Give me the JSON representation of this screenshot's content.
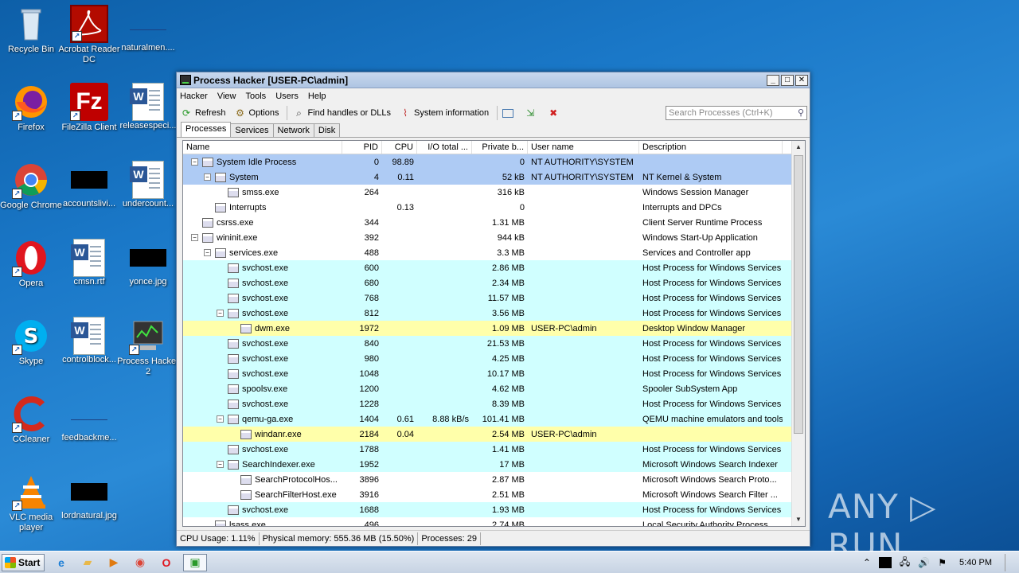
{
  "desktop": {
    "icons": [
      {
        "label": "Recycle Bin"
      },
      {
        "label": "Acrobat Reader DC"
      },
      {
        "label": "naturalmen...."
      },
      {
        "label": "Firefox"
      },
      {
        "label": "FileZilla Client"
      },
      {
        "label": "releasespeci..."
      },
      {
        "label": "Google Chrome"
      },
      {
        "label": "accountslivi..."
      },
      {
        "label": "undercount..."
      },
      {
        "label": "Opera"
      },
      {
        "label": "cmsn.rtf"
      },
      {
        "label": "yonce.jpg"
      },
      {
        "label": "Skype"
      },
      {
        "label": "controlblock..."
      },
      {
        "label": "Process Hacker 2"
      },
      {
        "label": "CCleaner"
      },
      {
        "label": "feedbackme..."
      },
      {
        "label": "VLC media player"
      },
      {
        "label": "lordnatural.jpg"
      }
    ]
  },
  "window": {
    "title": "Process Hacker [USER-PC\\admin]",
    "controls": {
      "minimize": "_",
      "maximize": "□",
      "close": "✕"
    },
    "menu": [
      "Hacker",
      "View",
      "Tools",
      "Users",
      "Help"
    ],
    "toolbar": {
      "refresh": "Refresh",
      "options": "Options",
      "find": "Find handles or DLLs",
      "sysinfo": "System information"
    },
    "search_placeholder": "Search Processes (Ctrl+K)",
    "tabs": [
      "Processes",
      "Services",
      "Network",
      "Disk"
    ],
    "columns": {
      "name": "Name",
      "pid": "PID",
      "cpu": "CPU",
      "io": "I/O total ...",
      "priv": "Private b...",
      "user": "User name",
      "desc": "Description"
    },
    "rows": [
      {
        "name": "System Idle Process",
        "pid": "0",
        "cpu": "98.89",
        "io": "",
        "priv": "0",
        "user": "NT AUTHORITY\\SYSTEM",
        "desc": "",
        "depth": 0,
        "toggle": "−",
        "color": "blue"
      },
      {
        "name": "System",
        "pid": "4",
        "cpu": "0.11",
        "io": "",
        "priv": "52 kB",
        "user": "NT AUTHORITY\\SYSTEM",
        "desc": "NT Kernel & System",
        "depth": 1,
        "toggle": "−",
        "color": "blue"
      },
      {
        "name": "smss.exe",
        "pid": "264",
        "cpu": "",
        "io": "",
        "priv": "316 kB",
        "user": "",
        "desc": "Windows Session Manager",
        "depth": 2,
        "toggle": "",
        "color": "white"
      },
      {
        "name": "Interrupts",
        "pid": "",
        "cpu": "0.13",
        "io": "",
        "priv": "0",
        "user": "",
        "desc": "Interrupts and DPCs",
        "depth": 1,
        "toggle": "",
        "color": "white"
      },
      {
        "name": "csrss.exe",
        "pid": "344",
        "cpu": "",
        "io": "",
        "priv": "1.31 MB",
        "user": "",
        "desc": "Client Server Runtime Process",
        "depth": 0,
        "toggle": "",
        "color": "white"
      },
      {
        "name": "wininit.exe",
        "pid": "392",
        "cpu": "",
        "io": "",
        "priv": "944 kB",
        "user": "",
        "desc": "Windows Start-Up Application",
        "depth": 0,
        "toggle": "−",
        "color": "white"
      },
      {
        "name": "services.exe",
        "pid": "488",
        "cpu": "",
        "io": "",
        "priv": "3.3 MB",
        "user": "",
        "desc": "Services and Controller app",
        "depth": 1,
        "toggle": "−",
        "color": "white"
      },
      {
        "name": "svchost.exe",
        "pid": "600",
        "cpu": "",
        "io": "",
        "priv": "2.86 MB",
        "user": "",
        "desc": "Host Process for Windows Services",
        "depth": 2,
        "toggle": "",
        "color": "cyan"
      },
      {
        "name": "svchost.exe",
        "pid": "680",
        "cpu": "",
        "io": "",
        "priv": "2.34 MB",
        "user": "",
        "desc": "Host Process for Windows Services",
        "depth": 2,
        "toggle": "",
        "color": "cyan"
      },
      {
        "name": "svchost.exe",
        "pid": "768",
        "cpu": "",
        "io": "",
        "priv": "11.57 MB",
        "user": "",
        "desc": "Host Process for Windows Services",
        "depth": 2,
        "toggle": "",
        "color": "cyan"
      },
      {
        "name": "svchost.exe",
        "pid": "812",
        "cpu": "",
        "io": "",
        "priv": "3.56 MB",
        "user": "",
        "desc": "Host Process for Windows Services",
        "depth": 2,
        "toggle": "−",
        "color": "cyan"
      },
      {
        "name": "dwm.exe",
        "pid": "1972",
        "cpu": "",
        "io": "",
        "priv": "1.09 MB",
        "user": "USER-PC\\admin",
        "desc": "Desktop Window Manager",
        "depth": 3,
        "toggle": "",
        "color": "yellow"
      },
      {
        "name": "svchost.exe",
        "pid": "840",
        "cpu": "",
        "io": "",
        "priv": "21.53 MB",
        "user": "",
        "desc": "Host Process for Windows Services",
        "depth": 2,
        "toggle": "",
        "color": "cyan"
      },
      {
        "name": "svchost.exe",
        "pid": "980",
        "cpu": "",
        "io": "",
        "priv": "4.25 MB",
        "user": "",
        "desc": "Host Process for Windows Services",
        "depth": 2,
        "toggle": "",
        "color": "cyan"
      },
      {
        "name": "svchost.exe",
        "pid": "1048",
        "cpu": "",
        "io": "",
        "priv": "10.17 MB",
        "user": "",
        "desc": "Host Process for Windows Services",
        "depth": 2,
        "toggle": "",
        "color": "cyan"
      },
      {
        "name": "spoolsv.exe",
        "pid": "1200",
        "cpu": "",
        "io": "",
        "priv": "4.62 MB",
        "user": "",
        "desc": "Spooler SubSystem App",
        "depth": 2,
        "toggle": "",
        "color": "cyan"
      },
      {
        "name": "svchost.exe",
        "pid": "1228",
        "cpu": "",
        "io": "",
        "priv": "8.39 MB",
        "user": "",
        "desc": "Host Process for Windows Services",
        "depth": 2,
        "toggle": "",
        "color": "cyan"
      },
      {
        "name": "qemu-ga.exe",
        "pid": "1404",
        "cpu": "0.61",
        "io": "8.88 kB/s",
        "priv": "101.41 MB",
        "user": "",
        "desc": "QEMU machine emulators and tools",
        "depth": 2,
        "toggle": "−",
        "color": "cyan"
      },
      {
        "name": "windanr.exe",
        "pid": "2184",
        "cpu": "0.04",
        "io": "",
        "priv": "2.54 MB",
        "user": "USER-PC\\admin",
        "desc": "",
        "depth": 3,
        "toggle": "",
        "color": "yellow"
      },
      {
        "name": "svchost.exe",
        "pid": "1788",
        "cpu": "",
        "io": "",
        "priv": "1.41 MB",
        "user": "",
        "desc": "Host Process for Windows Services",
        "depth": 2,
        "toggle": "",
        "color": "cyan"
      },
      {
        "name": "SearchIndexer.exe",
        "pid": "1952",
        "cpu": "",
        "io": "",
        "priv": "17 MB",
        "user": "",
        "desc": "Microsoft Windows Search Indexer",
        "depth": 2,
        "toggle": "−",
        "color": "cyan"
      },
      {
        "name": "SearchProtocolHos...",
        "pid": "3896",
        "cpu": "",
        "io": "",
        "priv": "2.87 MB",
        "user": "",
        "desc": "Microsoft Windows Search Proto...",
        "depth": 3,
        "toggle": "",
        "color": "white"
      },
      {
        "name": "SearchFilterHost.exe",
        "pid": "3916",
        "cpu": "",
        "io": "",
        "priv": "2.51 MB",
        "user": "",
        "desc": "Microsoft Windows Search Filter ...",
        "depth": 3,
        "toggle": "",
        "color": "white"
      },
      {
        "name": "svchost.exe",
        "pid": "1688",
        "cpu": "",
        "io": "",
        "priv": "1.93 MB",
        "user": "",
        "desc": "Host Process for Windows Services",
        "depth": 2,
        "toggle": "",
        "color": "cyan"
      },
      {
        "name": "lsass.exe",
        "pid": "496",
        "cpu": "",
        "io": "",
        "priv": "2.74 MB",
        "user": "",
        "desc": "Local Security Authority Process",
        "depth": 1,
        "toggle": "",
        "color": "white"
      }
    ],
    "status": {
      "cpu": "CPU Usage: 1.11%",
      "memory": "Physical memory: 555.36 MB (15.50%)",
      "processes": "Processes: 29"
    }
  },
  "taskbar": {
    "start": "Start",
    "clock": "5:40 PM"
  },
  "watermark": "ANY ▷ RUN"
}
